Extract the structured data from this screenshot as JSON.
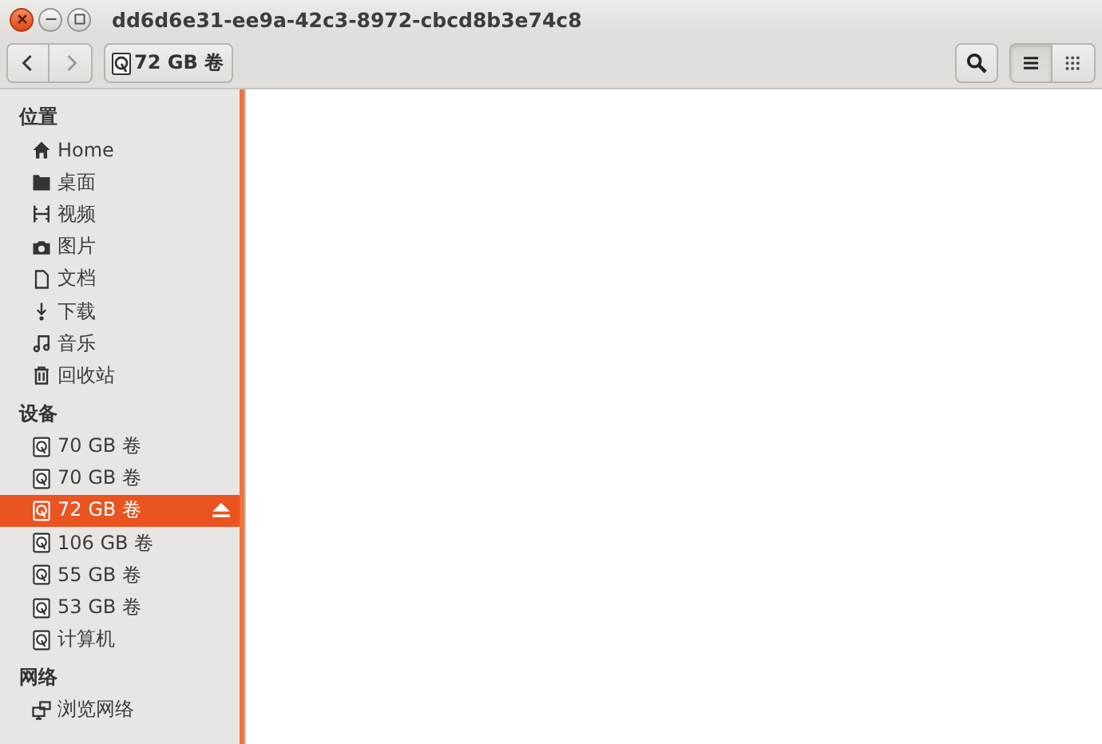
{
  "window": {
    "title": "dd6d6e31-ee9a-42c3-8972-cbcd8b3e74c8"
  },
  "toolbar": {
    "path_button": "72 GB 卷",
    "views": [
      {
        "kind": "list",
        "selected": true
      },
      {
        "kind": "grid",
        "selected": false
      }
    ]
  },
  "sidebar": {
    "sections": [
      {
        "title": "位置",
        "items": [
          {
            "kind": "home",
            "label": "Home",
            "selected": false,
            "eject": false
          },
          {
            "kind": "folder",
            "label": "桌面",
            "selected": false,
            "eject": false
          },
          {
            "kind": "film",
            "label": "视频",
            "selected": false,
            "eject": false
          },
          {
            "kind": "camera",
            "label": "图片",
            "selected": false,
            "eject": false
          },
          {
            "kind": "document",
            "label": "文档",
            "selected": false,
            "eject": false
          },
          {
            "kind": "download",
            "label": "下载",
            "selected": false,
            "eject": false
          },
          {
            "kind": "music",
            "label": "音乐",
            "selected": false,
            "eject": false
          },
          {
            "kind": "trash",
            "label": "回收站",
            "selected": false,
            "eject": false
          }
        ]
      },
      {
        "title": "设备",
        "items": [
          {
            "kind": "drive",
            "label": "70 GB 卷",
            "selected": false,
            "eject": false
          },
          {
            "kind": "drive",
            "label": "70 GB 卷",
            "selected": false,
            "eject": false
          },
          {
            "kind": "drive",
            "label": "72 GB 卷",
            "selected": true,
            "eject": true
          },
          {
            "kind": "drive",
            "label": "106 GB 卷",
            "selected": false,
            "eject": false
          },
          {
            "kind": "drive",
            "label": "55 GB 卷",
            "selected": false,
            "eject": false
          },
          {
            "kind": "drive",
            "label": "53 GB 卷",
            "selected": false,
            "eject": false
          },
          {
            "kind": "drive",
            "label": "计算机",
            "selected": false,
            "eject": false
          }
        ]
      },
      {
        "title": "网络",
        "items": [
          {
            "kind": "network",
            "label": "浏览网络",
            "selected": false,
            "eject": false
          }
        ]
      }
    ]
  }
}
